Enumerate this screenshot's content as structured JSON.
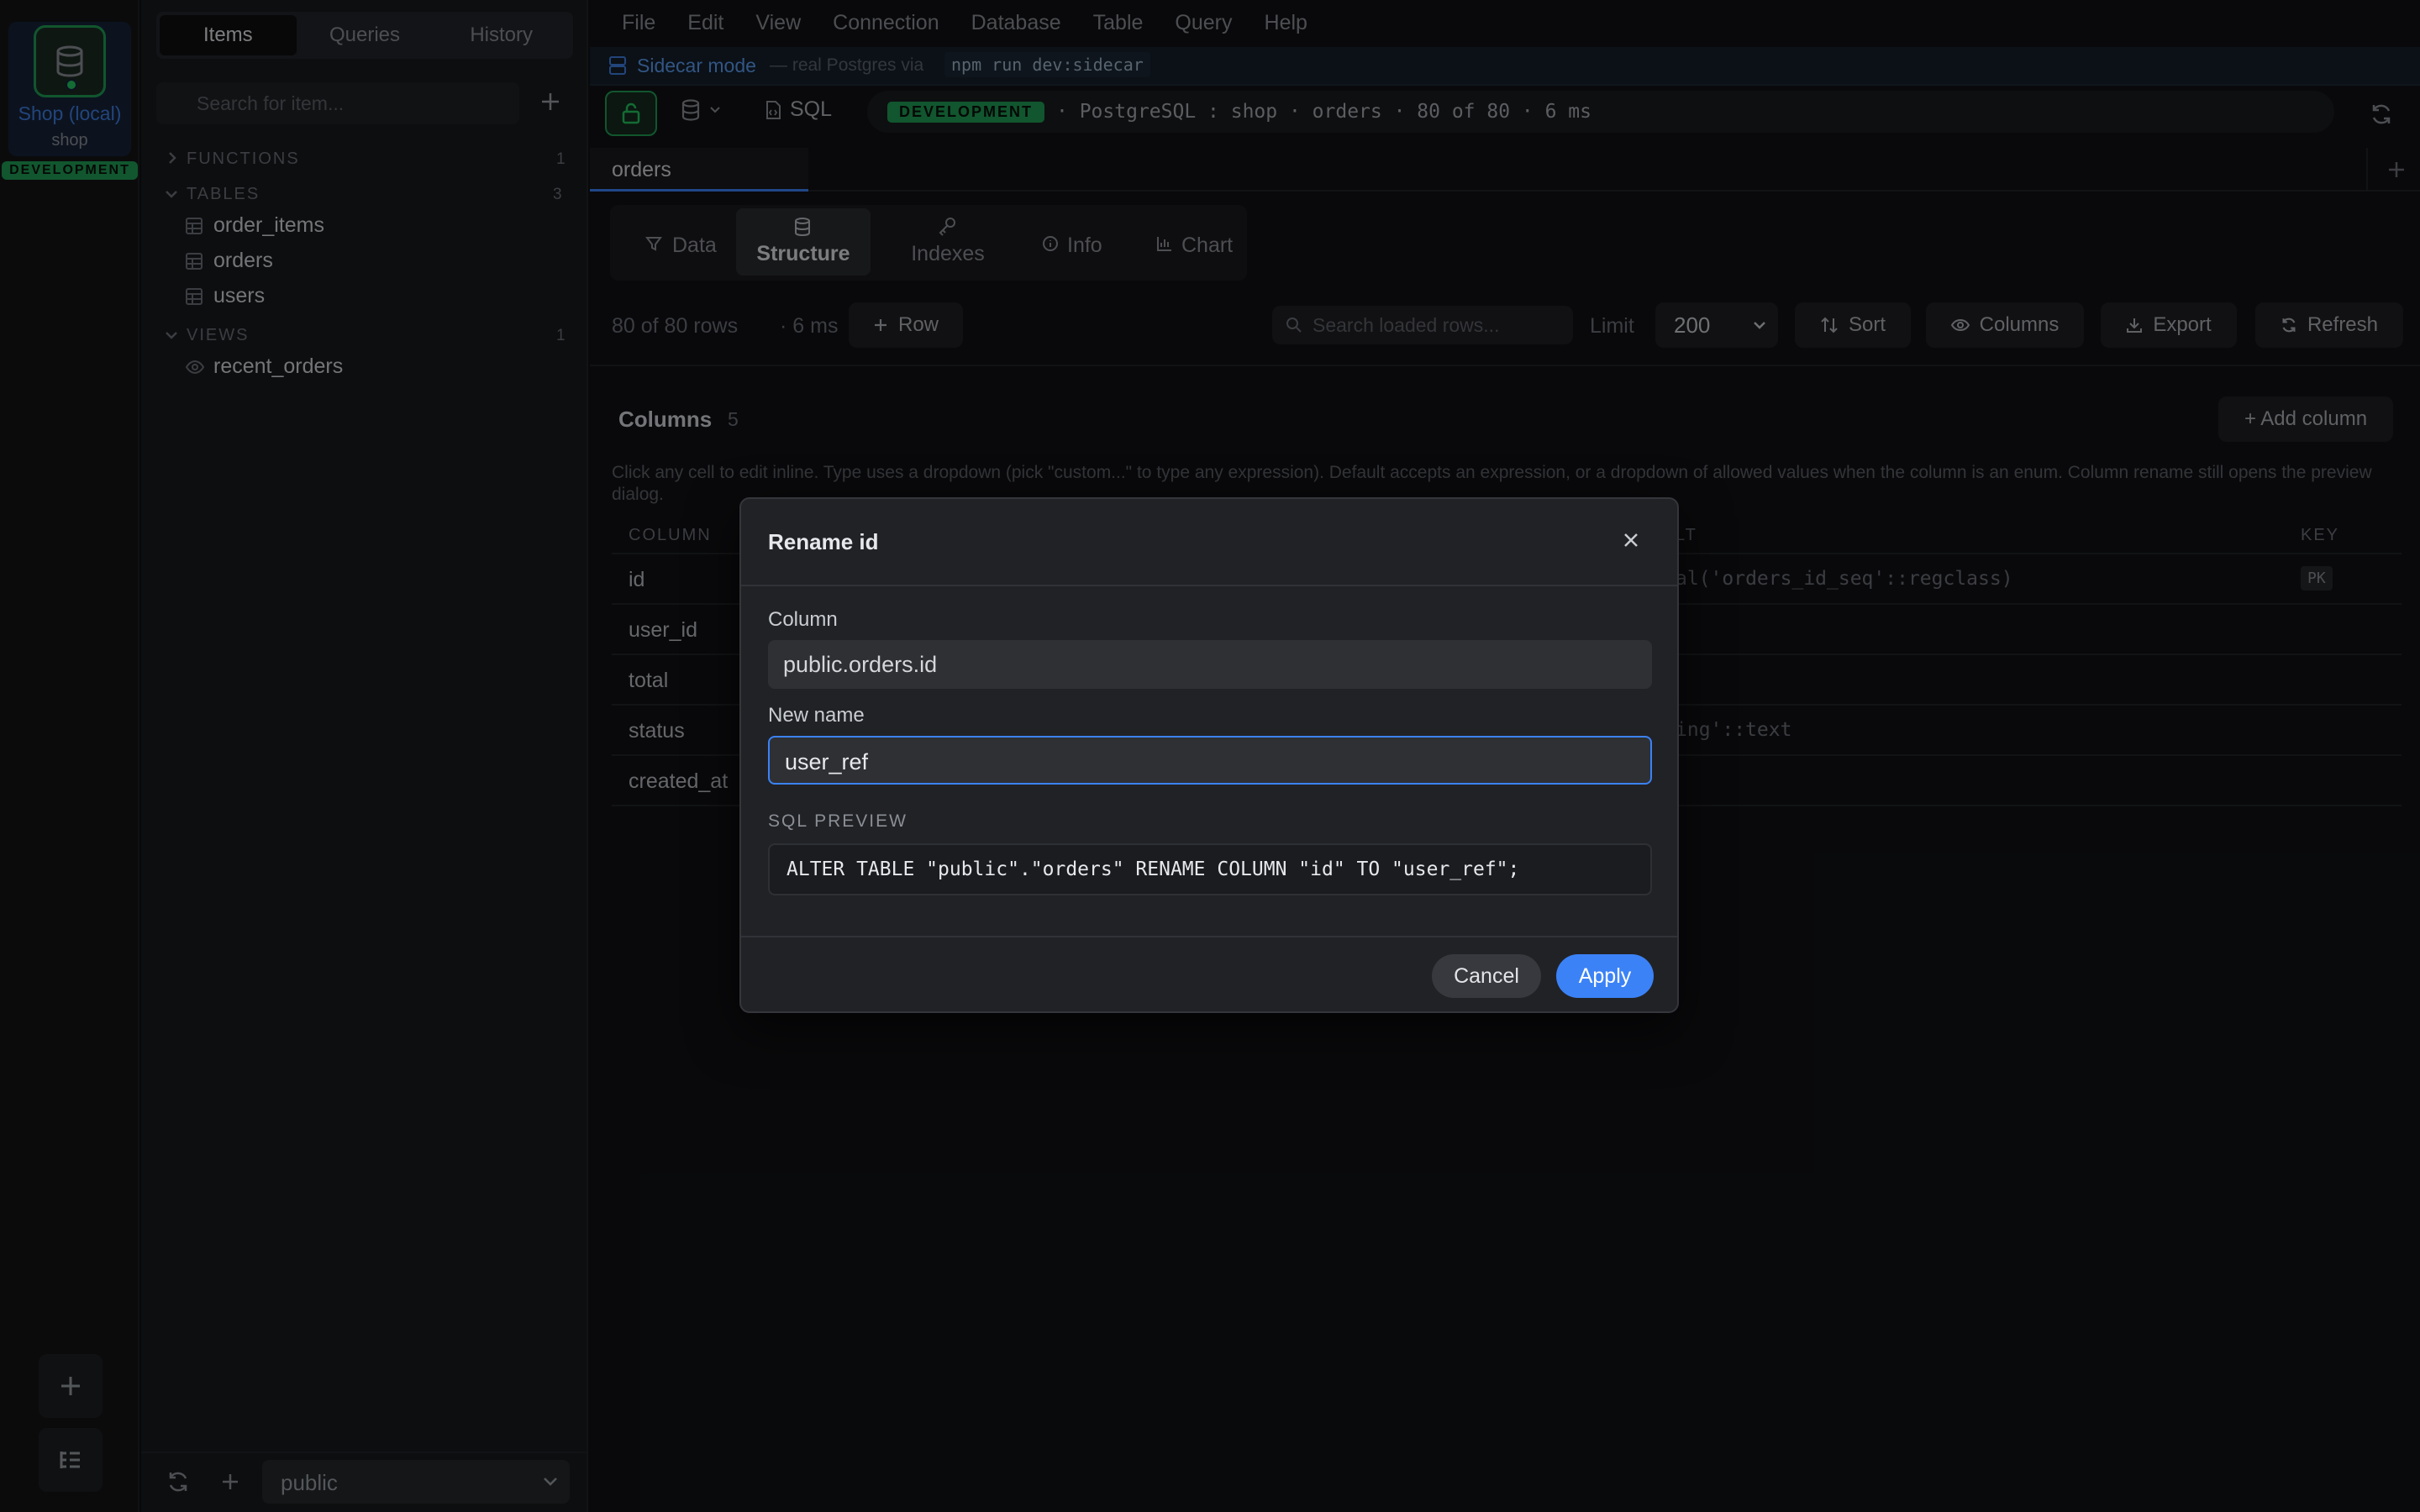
{
  "rail": {
    "connection_name": "Shop (local)",
    "connection_db": "shop",
    "env_badge": "DEVELOPMENT"
  },
  "sidebar": {
    "tabs": [
      "Items",
      "Queries",
      "History"
    ],
    "search_placeholder": "Search for item...",
    "sections": {
      "functions": {
        "label": "FUNCTIONS",
        "count": "1"
      },
      "tables": {
        "label": "TABLES",
        "count": "3",
        "items": [
          "order_items",
          "orders",
          "users"
        ]
      },
      "views": {
        "label": "VIEWS",
        "count": "1",
        "items": [
          "recent_orders"
        ]
      }
    },
    "schema": "public"
  },
  "menu": [
    "File",
    "Edit",
    "View",
    "Connection",
    "Database",
    "Table",
    "Query",
    "Help"
  ],
  "banner": {
    "title": "Sidecar mode",
    "desc": "— real Postgres via",
    "command": "npm run dev:sidecar"
  },
  "toolbar": {
    "sql_label": "SQL",
    "env": "DEVELOPMENT",
    "path": "· PostgreSQL : shop · orders · 80 of 80 · 6 ms"
  },
  "tab": {
    "name": "orders"
  },
  "view_tabs": [
    "Data",
    "Structure",
    "Indexes",
    "Info",
    "Chart"
  ],
  "status": {
    "rows": "80 of 80 rows",
    "time": "· 6 ms",
    "row_button": "Row",
    "search_placeholder": "Search loaded rows...",
    "limit_label": "Limit",
    "limit_value": "200",
    "sort": "Sort",
    "columns": "Columns",
    "export": "Export",
    "refresh": "Refresh"
  },
  "structure": {
    "title": "Columns",
    "count": "5",
    "add_column": "+ Add column",
    "help": "Click any cell to edit inline. Type uses a dropdown (pick \"custom...\" to type any expression). Default accepts an expression, or a dropdown of allowed values when the column is an enum. Column rename still opens the preview dialog.",
    "headers": {
      "column": "COLUMN",
      "default": "LT",
      "key": "KEY"
    },
    "rows": [
      {
        "name": "id",
        "default": "al('orders_id_seq'::regclass)",
        "key": "PK"
      },
      {
        "name": "user_id",
        "default": "",
        "key": ""
      },
      {
        "name": "total",
        "default": "",
        "key": ""
      },
      {
        "name": "status",
        "default": "ing'::text",
        "key": ""
      },
      {
        "name": "created_at",
        "default": "",
        "key": ""
      }
    ]
  },
  "dialog": {
    "title": "Rename id",
    "column_label": "Column",
    "column_value": "public.orders.id",
    "new_name_label": "New name",
    "new_name_value": "user_ref",
    "preview_label": "SQL PREVIEW",
    "sql": "ALTER TABLE \"public\".\"orders\" RENAME COLUMN \"id\" TO \"user_ref\";",
    "cancel": "Cancel",
    "apply": "Apply"
  },
  "colors": {
    "accent": "#3b82f6",
    "env": "#1f9d55"
  }
}
